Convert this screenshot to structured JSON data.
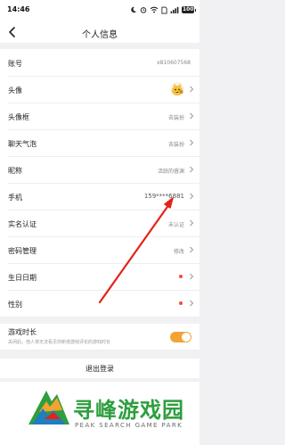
{
  "status_bar": {
    "time": "14:46",
    "battery": "100",
    "icons": [
      "moon-icon",
      "alarm-icon",
      "wifi-icon",
      "sim-icon",
      "signal-icon"
    ]
  },
  "nav": {
    "title": "个人信息",
    "back_icon": "chevron-left-icon"
  },
  "rows": [
    {
      "label": "账号",
      "value": "x810607568"
    },
    {
      "label": "头像",
      "value": ""
    },
    {
      "label": "头像框",
      "value": "去装扮"
    },
    {
      "label": "聊天气泡",
      "value": "去装扮"
    },
    {
      "label": "昵称",
      "value": "活跃的睿渊"
    },
    {
      "label": "手机",
      "value": "159****6881"
    },
    {
      "label": "实名认证",
      "value": "未认证"
    },
    {
      "label": "密码管理",
      "value": "修改"
    },
    {
      "label": "生日日期",
      "value": ""
    },
    {
      "label": "性别",
      "value": ""
    }
  ],
  "game_duration": {
    "label": "游戏时长",
    "description": "关闭后，他人将无法看见你新增游戏评论的游戏时长",
    "enabled": true
  },
  "logout_label": "退出登录",
  "watermark": {
    "title": "寻峰游戏园",
    "subtitle": "PEAK SEARCH GAME PARK"
  },
  "colors": {
    "accent_orange": "#f3a333",
    "red_dot": "#f04f36",
    "watermark_green": "#2e9e3e",
    "arrow_red": "#e2231a"
  }
}
